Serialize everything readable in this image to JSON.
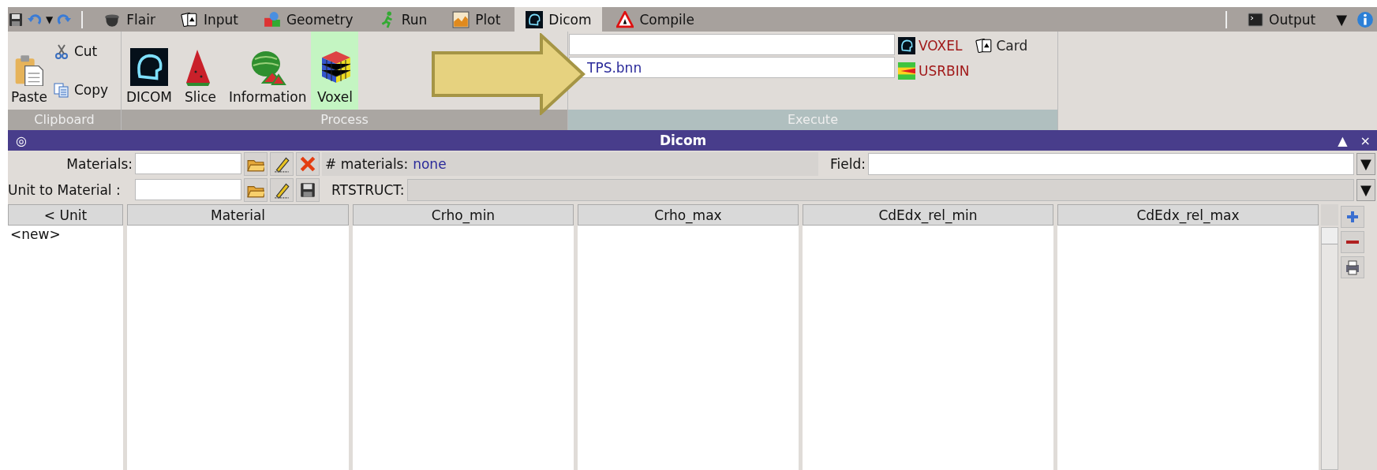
{
  "quick_access": {
    "undo_menu": "▼"
  },
  "tabs": [
    {
      "label": "Flair",
      "selected": false
    },
    {
      "label": "Input",
      "selected": false
    },
    {
      "label": "Geometry",
      "selected": false
    },
    {
      "label": "Run",
      "selected": false
    },
    {
      "label": "Plot",
      "selected": false
    },
    {
      "label": "Dicom",
      "selected": true
    },
    {
      "label": "Compile",
      "selected": false
    }
  ],
  "output_button": {
    "label": "Output",
    "menu": "▼"
  },
  "ribbon": {
    "clipboard": {
      "title": "Clipboard",
      "paste": "Paste",
      "cut": "Cut",
      "copy": "Copy"
    },
    "process": {
      "title": "Process",
      "buttons": [
        {
          "label": "DICOM",
          "selected": false
        },
        {
          "label": "Slice",
          "selected": false
        },
        {
          "label": "Information",
          "selected": false
        },
        {
          "label": "Voxel",
          "selected": true
        }
      ]
    },
    "execute": {
      "title": "Execute",
      "file_value": "TPS.bnn",
      "buttons": [
        {
          "label": "VOXEL"
        },
        {
          "label": "Card"
        },
        {
          "label": "USRBIN"
        }
      ]
    }
  },
  "panel": {
    "title": "Dicom",
    "icon": "◎",
    "collapse": "▲",
    "close": "×",
    "materials": {
      "label": "Materials:",
      "count_label": "# materials:",
      "count": "none"
    },
    "field": {
      "label": "Field:",
      "menu": "▼"
    },
    "unit_to_material": {
      "label": "Unit to Material :"
    },
    "rtstruct": {
      "label": "RTSTRUCT:",
      "menu": "▼"
    },
    "table": {
      "columns": [
        "< Unit",
        "Material",
        "Crho_min",
        "Crho_max",
        "CdEdx_rel_min",
        "CdEdx_rel_max"
      ],
      "rows": [
        [
          "<new>"
        ]
      ]
    }
  }
}
